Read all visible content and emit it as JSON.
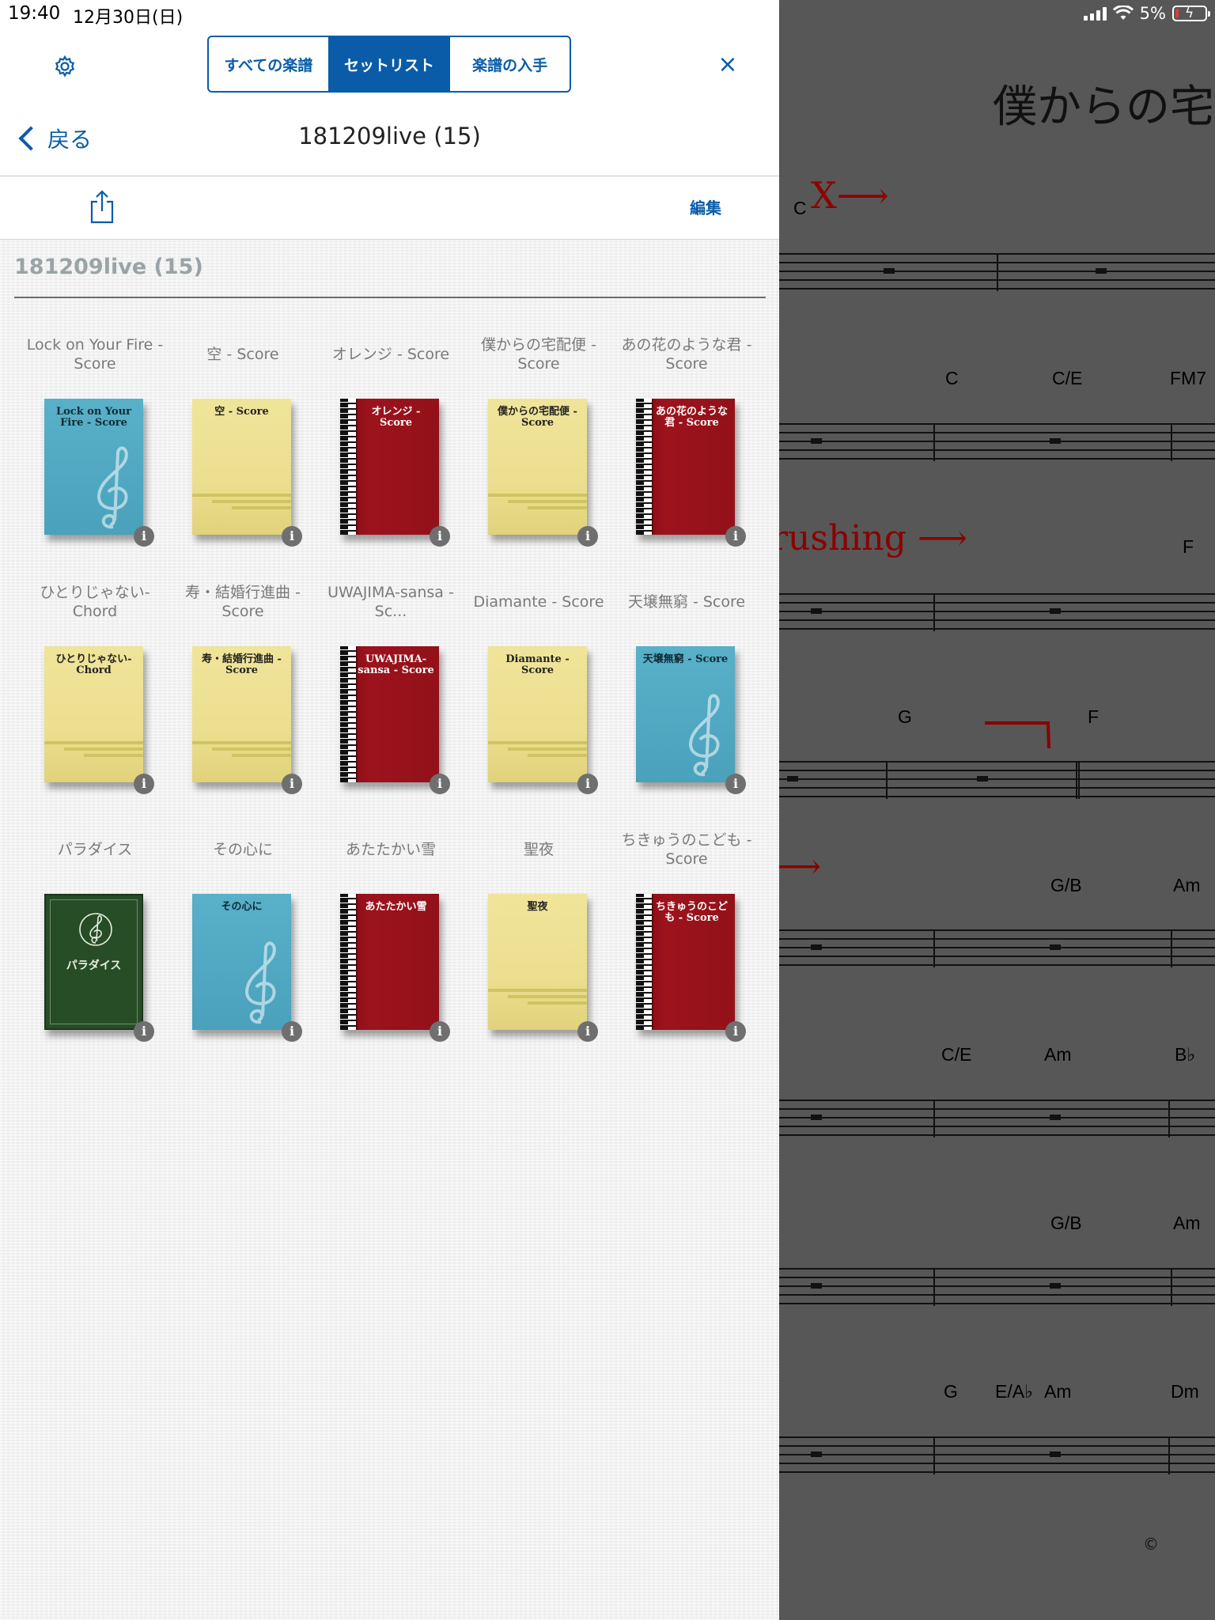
{
  "status_bar": {
    "time": "19:40",
    "date": "12月30日(日)",
    "battery": "5%"
  },
  "header": {
    "segments": [
      {
        "label": "すべての楽譜",
        "active": false
      },
      {
        "label": "セットリスト",
        "active": true
      },
      {
        "label": "楽譜の入手",
        "active": false
      }
    ],
    "close_symbol": "×",
    "back_label": "戻る",
    "title": "181209live (15)"
  },
  "toolbar": {
    "edit_label": "編集"
  },
  "section": {
    "title": "181209live (15)"
  },
  "books": [
    {
      "label": "Lock on Your Fire - Score",
      "cover_title": "Lock on Your Fire - Score",
      "style": "blue"
    },
    {
      "label": "空 - Score",
      "cover_title": "空 - Score",
      "style": "yellow"
    },
    {
      "label": "オレンジ - Score",
      "cover_title": "オレンジ - Score",
      "style": "red"
    },
    {
      "label": "僕からの宅配便 - Score",
      "cover_title": "僕からの宅配便 - Score",
      "style": "yellow"
    },
    {
      "label": "あの花のような君 - Score",
      "cover_title": "あの花のような君 - Score",
      "style": "red"
    },
    {
      "label": "ひとりじゃない-Chord",
      "cover_title": "ひとりじゃない-Chord",
      "style": "yellow"
    },
    {
      "label": "寿・結婚行進曲 - Score",
      "cover_title": "寿・結婚行進曲 - Score",
      "style": "yellow"
    },
    {
      "label": "UWAJIMA-sansa - Sc...",
      "cover_title": "UWAJIMA-sansa - Score",
      "style": "red"
    },
    {
      "label": "Diamante - Score",
      "cover_title": "Diamante - Score",
      "style": "yellow"
    },
    {
      "label": "天壌無窮 - Score",
      "cover_title": "天壌無窮 - Score",
      "style": "blue"
    },
    {
      "label": "パラダイス",
      "cover_title": "パラダイス",
      "style": "green"
    },
    {
      "label": "その心に",
      "cover_title": "その心に",
      "style": "blue"
    },
    {
      "label": "あたたかい雪",
      "cover_title": "あたたかい雪",
      "style": "red"
    },
    {
      "label": "聖夜",
      "cover_title": "聖夜",
      "style": "yellow"
    },
    {
      "label": "ちきゅうのこども - Score",
      "cover_title": "ちきゅうのこども - Score",
      "style": "red"
    }
  ],
  "info_symbol": "i",
  "score": {
    "title": "僕からの宅",
    "chords": [
      "C",
      "C",
      "C/E",
      "FM7",
      "F",
      "G",
      "F",
      "G/B",
      "Am",
      "C/E",
      "Am",
      "B♭",
      "G/B",
      "Am",
      "G",
      "E/A♭",
      "Am",
      "Dm"
    ],
    "annotations": [
      "X⟶",
      "rushing ⟶",
      "⟶",
      "⟶"
    ],
    "copyright": "©"
  },
  "colors": {
    "accent": "#0a5ca8",
    "panel_bg": "#f1f1f1",
    "overlay": "#575757",
    "annotation": "#8b0000"
  }
}
